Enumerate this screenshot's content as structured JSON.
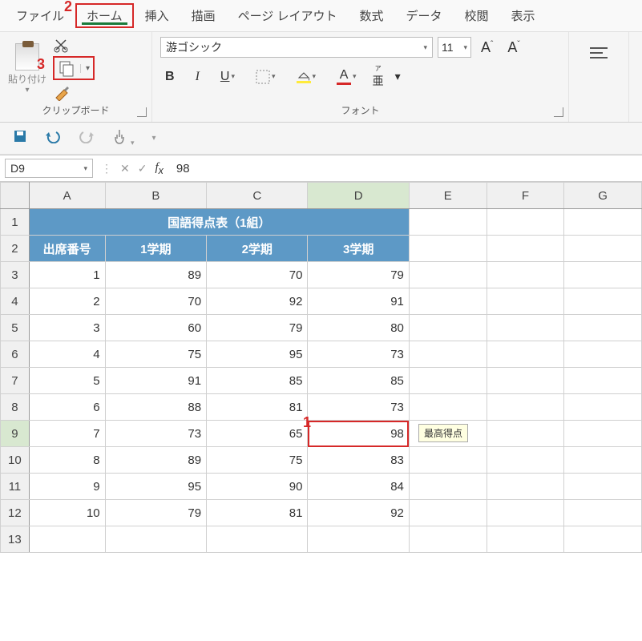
{
  "annotations": {
    "a1": "1",
    "a2": "2",
    "a3": "3"
  },
  "menu": {
    "file": "ファイル",
    "home": "ホーム",
    "insert": "挿入",
    "draw": "描画",
    "layout": "ページ レイアウト",
    "formula": "数式",
    "data": "データ",
    "review": "校閲",
    "view": "表示"
  },
  "clipboard": {
    "paste": "貼り付け",
    "group_label": "クリップボード"
  },
  "font": {
    "name": "游ゴシック",
    "size": "11",
    "group_label": "フォント",
    "bold": "B",
    "italic": "I",
    "underline": "U",
    "ruby_top": "ア亜",
    "ruby_kanji": "亜",
    "fontcol": "A"
  },
  "namebox": "D9",
  "formula_value": "98",
  "columns": [
    "A",
    "B",
    "C",
    "D",
    "E",
    "F",
    "G"
  ],
  "table": {
    "title": "国語得点表（1組）",
    "headers": {
      "a": "出席番号",
      "b": "1学期",
      "c": "2学期",
      "d": "3学期"
    },
    "rows": [
      {
        "n": "1",
        "b": "89",
        "c": "70",
        "d": "79"
      },
      {
        "n": "2",
        "b": "70",
        "c": "92",
        "d": "91"
      },
      {
        "n": "3",
        "b": "60",
        "c": "79",
        "d": "80"
      },
      {
        "n": "4",
        "b": "75",
        "c": "95",
        "d": "73"
      },
      {
        "n": "5",
        "b": "91",
        "c": "85",
        "d": "85"
      },
      {
        "n": "6",
        "b": "88",
        "c": "81",
        "d": "73"
      },
      {
        "n": "7",
        "b": "73",
        "c": "65",
        "d": "98"
      },
      {
        "n": "8",
        "b": "89",
        "c": "75",
        "d": "83"
      },
      {
        "n": "9",
        "b": "95",
        "c": "90",
        "d": "84"
      },
      {
        "n": "10",
        "b": "79",
        "c": "81",
        "d": "92"
      }
    ]
  },
  "tooltip": "最高得点",
  "selected_cell": "D9"
}
